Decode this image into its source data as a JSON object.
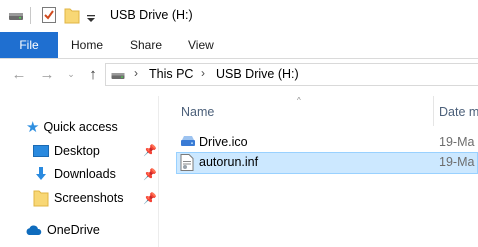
{
  "window": {
    "title": "USB Drive (H:)"
  },
  "ribbon": {
    "tabs": [
      "File",
      "Home",
      "Share",
      "View"
    ]
  },
  "address": {
    "crumbs": [
      "This PC",
      "USB Drive (H:)"
    ]
  },
  "nav": {
    "quick_access": "Quick access",
    "items": [
      {
        "label": "Desktop",
        "icon": "desktop-icon",
        "pinned": true
      },
      {
        "label": "Downloads",
        "icon": "downloads-icon",
        "pinned": true
      },
      {
        "label": "Screenshots",
        "icon": "folder-icon",
        "pinned": true
      }
    ],
    "onedrive": "OneDrive"
  },
  "list": {
    "columns": {
      "name": "Name",
      "date": "Date m"
    },
    "files": [
      {
        "name": "Drive.ico",
        "date": "19-Ma",
        "icon": "drive-ico-icon",
        "selected": false
      },
      {
        "name": "autorun.inf",
        "date": "19-Ma",
        "icon": "inf-file-icon",
        "selected": true
      }
    ]
  },
  "colors": {
    "accent": "#1f6fd0",
    "selection": "#cce8ff",
    "selection_border": "#99d1ff"
  }
}
